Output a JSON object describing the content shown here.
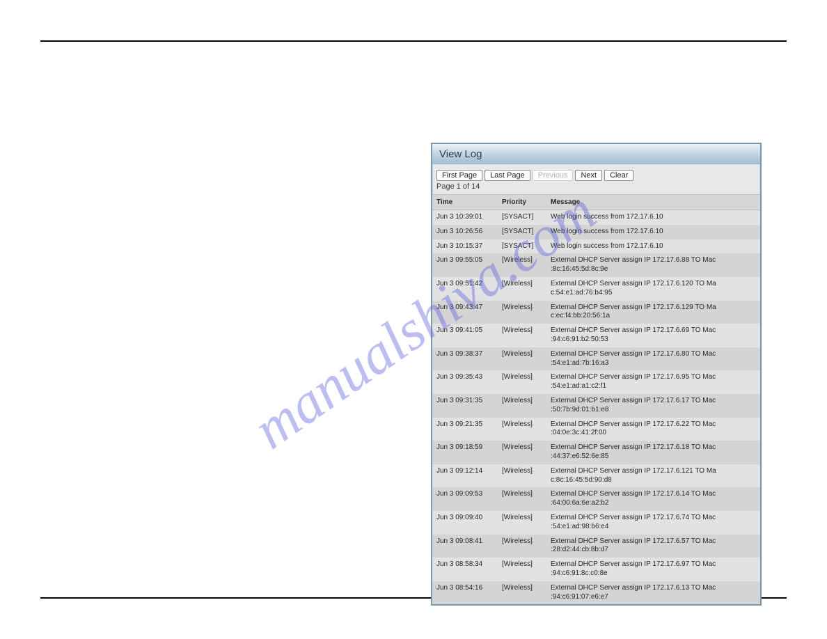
{
  "watermark": "manualshiva.com",
  "panel": {
    "title": "View Log",
    "buttons": {
      "first": "First Page",
      "last": "Last Page",
      "prev": "Previous",
      "next": "Next",
      "clear": "Clear"
    },
    "page_info": "Page 1 of 14",
    "headers": {
      "time": "Time",
      "priority": "Priority",
      "message": "Message"
    },
    "rows": [
      {
        "time": "Jun 3 10:39:01",
        "priority": "[SYSACT]",
        "message": "Web login success from 172.17.6.10"
      },
      {
        "time": "Jun 3 10:26:56",
        "priority": "[SYSACT]",
        "message": "Web login success from 172.17.6.10"
      },
      {
        "time": "Jun 3 10:15:37",
        "priority": "[SYSACT]",
        "message": "Web login success from 172.17.6.10"
      },
      {
        "time": "Jun 3 09:55:05",
        "priority": "[Wireless]",
        "message": "External DHCP Server assign IP 172.17.6.88 TO Mac :8c:16:45:5d:8c:9e"
      },
      {
        "time": "Jun 3 09:51:42",
        "priority": "[Wireless]",
        "message": "External DHCP Server assign IP 172.17.6.120 TO Ma c:54:e1:ad:76:b4:95"
      },
      {
        "time": "Jun 3 09:43:47",
        "priority": "[Wireless]",
        "message": "External DHCP Server assign IP 172.17.6.129 TO Ma c:ec:f4:bb:20:56:1a"
      },
      {
        "time": "Jun 3 09:41:05",
        "priority": "[Wireless]",
        "message": "External DHCP Server assign IP 172.17.6.69 TO Mac :94:c6:91:b2:50:53"
      },
      {
        "time": "Jun 3 09:38:37",
        "priority": "[Wireless]",
        "message": "External DHCP Server assign IP 172.17.6.80 TO Mac :54:e1:ad:7b:16:a3"
      },
      {
        "time": "Jun 3 09:35:43",
        "priority": "[Wireless]",
        "message": "External DHCP Server assign IP 172.17.6.95 TO Mac :54:e1:ad:a1:c2:f1"
      },
      {
        "time": "Jun 3 09:31:35",
        "priority": "[Wireless]",
        "message": "External DHCP Server assign IP 172.17.6.17 TO Mac :50:7b:9d:01:b1:e8"
      },
      {
        "time": "Jun 3 09:21:35",
        "priority": "[Wireless]",
        "message": "External DHCP Server assign IP 172.17.6.22 TO Mac :04:0e:3c:41:2f:00"
      },
      {
        "time": "Jun 3 09:18:59",
        "priority": "[Wireless]",
        "message": "External DHCP Server assign IP 172.17.6.18 TO Mac :44:37:e6:52:6e:85"
      },
      {
        "time": "Jun 3 09:12:14",
        "priority": "[Wireless]",
        "message": "External DHCP Server assign IP 172.17.6.121 TO Ma c:8c:16:45:5d:90:d8"
      },
      {
        "time": "Jun 3 09:09:53",
        "priority": "[Wireless]",
        "message": "External DHCP Server assign IP 172.17.6.14 TO Mac :64:00:6a:6e:a2:b2"
      },
      {
        "time": "Jun 3 09:09:40",
        "priority": "[Wireless]",
        "message": "External DHCP Server assign IP 172.17.6.74 TO Mac :54:e1:ad:98:b6:e4"
      },
      {
        "time": "Jun 3 09:08:41",
        "priority": "[Wireless]",
        "message": "External DHCP Server assign IP 172.17.6.57 TO Mac :28:d2:44:cb:8b:d7"
      },
      {
        "time": "Jun 3 08:58:34",
        "priority": "[Wireless]",
        "message": "External DHCP Server assign IP 172.17.6.97 TO Mac :94:c6:91:8c:c0:8e"
      },
      {
        "time": "Jun 3 08:54:16",
        "priority": "[Wireless]",
        "message": "External DHCP Server assign IP 172.17.6.13 TO Mac :94:c6:91:07:e6:e7"
      }
    ]
  }
}
